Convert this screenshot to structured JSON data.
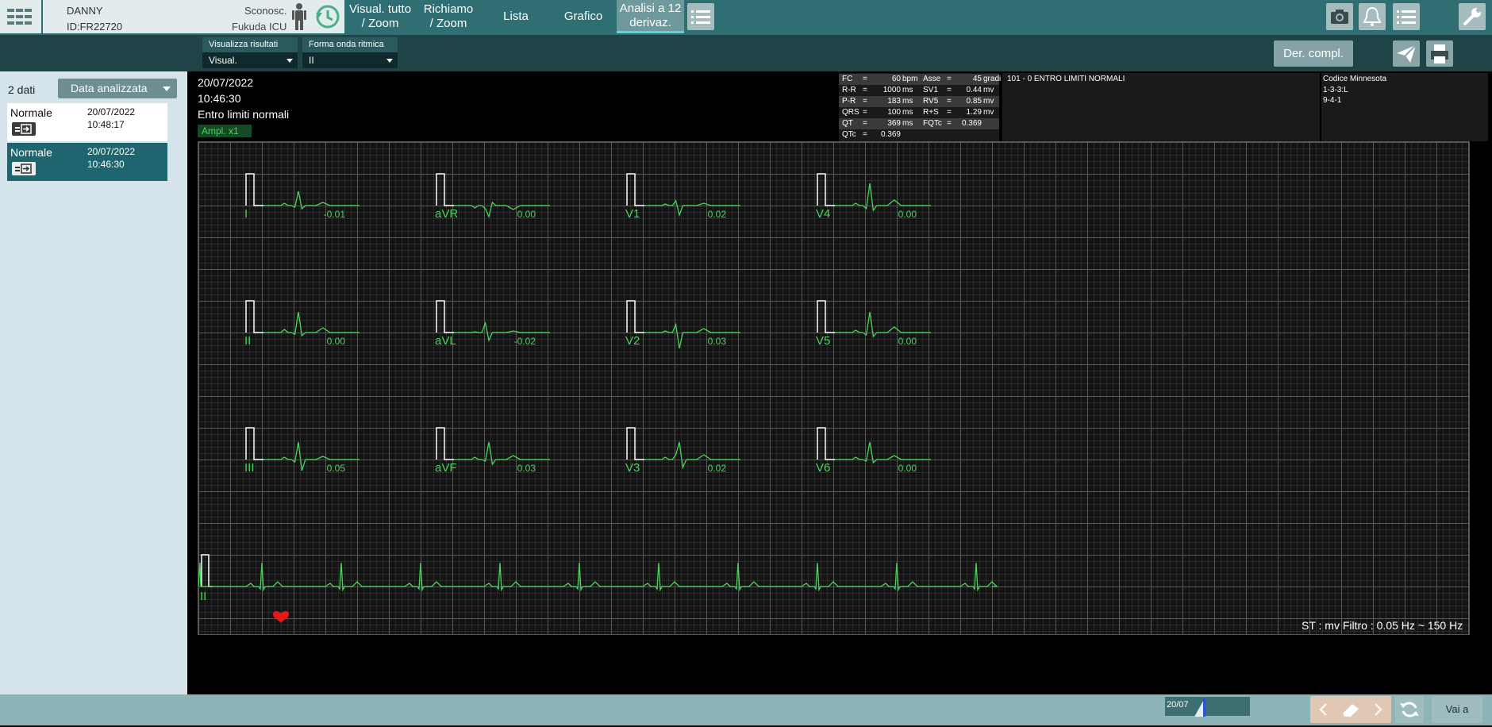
{
  "patient": {
    "name": "DANNY",
    "id": "ID:FR22720",
    "condition": "Sconosc.",
    "ward": "Fukuda ICU"
  },
  "tabs": [
    {
      "label_line1": "Visual. tutto",
      "label_line2": "/ Zoom"
    },
    {
      "label_line1": "Richiamo",
      "label_line2": "/ Zoom"
    },
    {
      "label_line1": "Lista",
      "label_line2": ""
    },
    {
      "label_line1": "Grafico",
      "label_line2": ""
    },
    {
      "label_line1": "Analisi a 12",
      "label_line2": "derivaz."
    }
  ],
  "subbar": {
    "result_label": "Visualizza risultati",
    "result_value": "Visual.",
    "rhythm_label": "Forma onda ritmica",
    "rhythm_value": "II",
    "der_compl": "Der. compl."
  },
  "left": {
    "count": "2 dati",
    "sort": "Data analizzata",
    "records": [
      {
        "state": "Normale",
        "date": "20/07/2022",
        "time": "10:48:17",
        "selected": false
      },
      {
        "state": "Normale",
        "date": "20/07/2022",
        "time": "10:46:30",
        "selected": true
      }
    ]
  },
  "ecg": {
    "date": "20/07/2022",
    "time": "10:46:30",
    "status": "Entro limiti normali",
    "ampl": "Ampl.  x1",
    "filter": "ST : mv Filtro : 0.05 Hz ~ 150 Hz"
  },
  "measurements": [
    {
      "k1": "FC",
      "v1": "60",
      "u1": "bpm",
      "k2": "Asse",
      "v2": "45",
      "u2": "gradi"
    },
    {
      "k1": "R-R",
      "v1": "1000",
      "u1": "ms",
      "k2": "SV1",
      "v2": "0.44",
      "u2": "mv"
    },
    {
      "k1": "P-R",
      "v1": "183",
      "u1": "ms",
      "k2": "RV5",
      "v2": "0.85",
      "u2": "mv"
    },
    {
      "k1": "QRS",
      "v1": "100",
      "u1": "ms",
      "k2": "R+S",
      "v2": "1.29",
      "u2": "mv"
    },
    {
      "k1": "QT",
      "v1": "369",
      "u1": "ms",
      "k2": "FQTc",
      "v2": "0.369",
      "u2": ""
    },
    {
      "k1": "QTc",
      "v1": "0.369",
      "u1": "",
      "k2": "",
      "v2": "",
      "u2": ""
    }
  ],
  "interpretation": "101 - 0 ENTRO LIMITI NORMALI",
  "minnesota": {
    "title": "Codice Minnesota",
    "codes": [
      "1-3-3:L",
      "9-4-1"
    ]
  },
  "leads": [
    {
      "name": "I",
      "st": "-0.01",
      "col": 0,
      "row": 0
    },
    {
      "name": "aVR",
      "st": "0.00",
      "col": 1,
      "row": 0
    },
    {
      "name": "V1",
      "st": "0.02",
      "col": 2,
      "row": 0
    },
    {
      "name": "V4",
      "st": "0.00",
      "col": 3,
      "row": 0
    },
    {
      "name": "II",
      "st": "0.00",
      "col": 0,
      "row": 1
    },
    {
      "name": "aVL",
      "st": "-0.02",
      "col": 1,
      "row": 1
    },
    {
      "name": "V2",
      "st": "0.03",
      "col": 2,
      "row": 1
    },
    {
      "name": "V5",
      "st": "0.00",
      "col": 3,
      "row": 1
    },
    {
      "name": "III",
      "st": "0.05",
      "col": 0,
      "row": 2
    },
    {
      "name": "aVF",
      "st": "0.03",
      "col": 1,
      "row": 2
    },
    {
      "name": "V3",
      "st": "0.02",
      "col": 2,
      "row": 2
    },
    {
      "name": "V6",
      "st": "0.00",
      "col": 3,
      "row": 2
    }
  ],
  "rhythm_lead": "II",
  "timeline": {
    "date": "20/07"
  },
  "bottom": {
    "goto": "Vai a"
  },
  "colors": {
    "trace": "#49d55b",
    "accent": "#2f6f73",
    "selected": "#1f6570",
    "heart": "#e81818"
  }
}
